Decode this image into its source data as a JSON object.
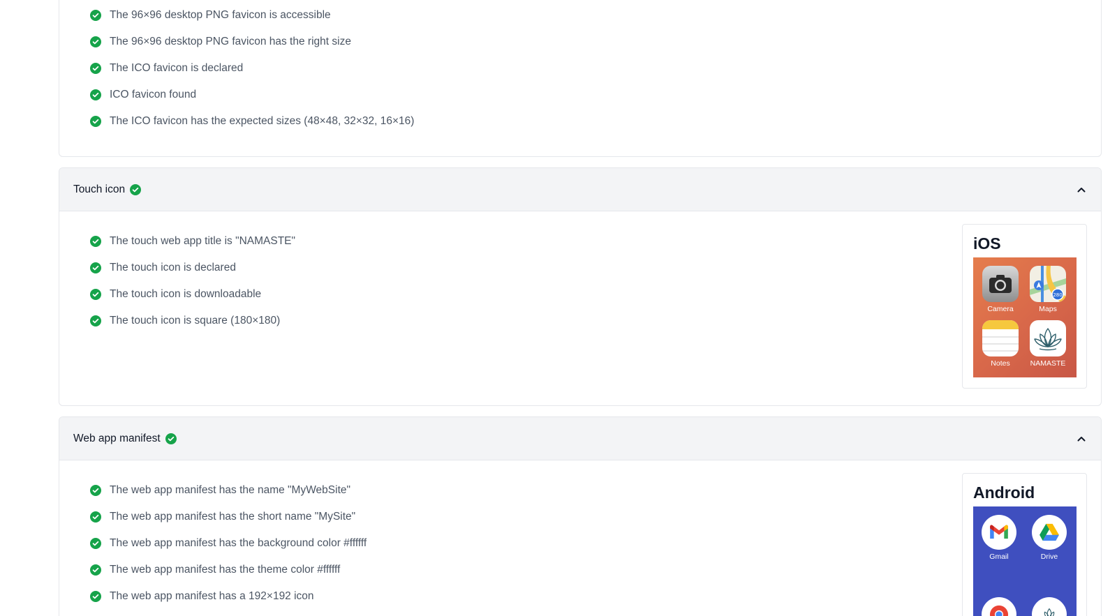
{
  "favicon_checks": [
    "The 96×96 desktop PNG favicon is accessible",
    "The 96×96 desktop PNG favicon has the right size",
    "The ICO favicon is declared",
    "ICO favicon found",
    "The ICO favicon has the expected sizes (48×48, 32×32, 16×16)"
  ],
  "touch_section": {
    "title": "Touch icon",
    "checks": [
      "The touch web app title is \"NAMASTE\"",
      "The touch icon is declared",
      "The touch icon is downloadable",
      "The touch icon is square (180×180)"
    ],
    "preview": {
      "title": "iOS",
      "apps": [
        "Camera",
        "Maps",
        "Notes",
        "NAMASTE"
      ]
    }
  },
  "manifest_section": {
    "title": "Web app manifest",
    "checks": [
      "The web app manifest has the name \"MyWebSite\"",
      "The web app manifest has the short name \"MySite\"",
      "The web app manifest has the background color #ffffff",
      "The web app manifest has the theme color #ffffff",
      "The web app manifest has a 192×192 icon"
    ],
    "preview": {
      "title": "Android",
      "apps": [
        "Gmail",
        "Drive"
      ]
    }
  },
  "colors": {
    "check_green": "#16a34a",
    "ios_background": "#d9694a",
    "android_background": "#3f4fbf"
  },
  "icons": [
    "check-circle-icon",
    "chevron-up-icon"
  ]
}
